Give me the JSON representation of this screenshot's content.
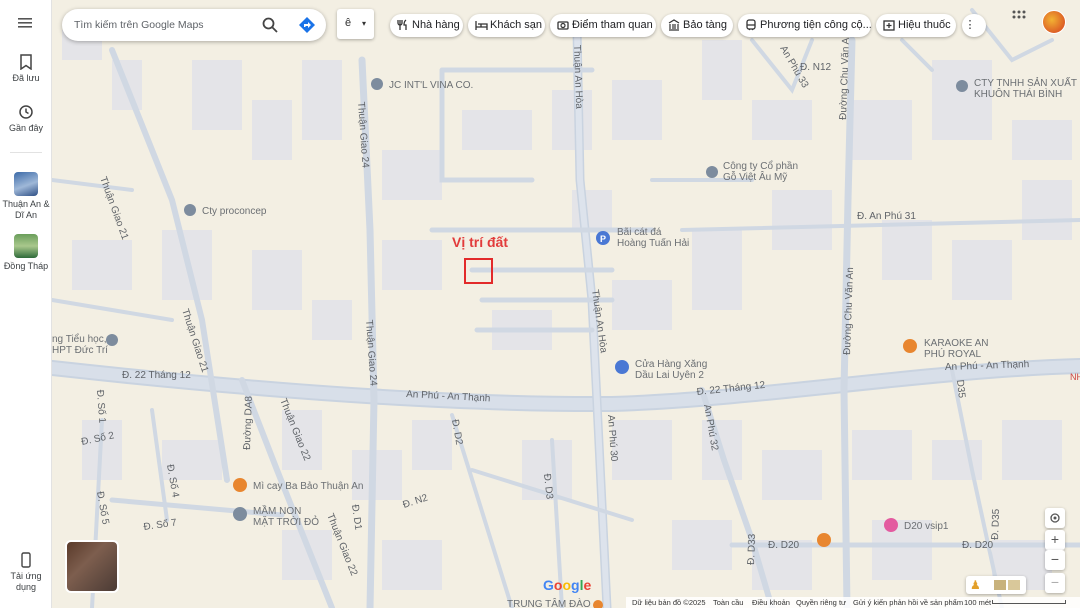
{
  "search": {
    "placeholder": "Tìm kiếm trên Google Maps",
    "menu_label": "Menu"
  },
  "lang": {
    "label": "ê"
  },
  "chips": [
    {
      "label": "Nhà hàng",
      "icon": "fork-knife-icon"
    },
    {
      "label": "Khách sạn",
      "icon": "bed-icon"
    },
    {
      "label": "Điểm tham quan",
      "icon": "camera-icon"
    },
    {
      "label": "Bảo tàng",
      "icon": "museum-icon"
    },
    {
      "label": "Phương tiện công cộ...",
      "icon": "transit-icon"
    },
    {
      "label": "Hiệu thuốc",
      "icon": "pharmacy-icon"
    }
  ],
  "rail": {
    "saved": "Đã lưu",
    "recent": "Gần đây",
    "recent1": "Thuận An & Dĩ An",
    "recent2": "Đồng Tháp",
    "get_app": "Tải ứng dụng"
  },
  "annotation": {
    "title": "Vị trí đất",
    "color": "#e23b3b"
  },
  "streets": {
    "s22thang12_a": "Đ. 22 Tháng 12",
    "s22thang12_b": "Đ. 22 Tháng 12",
    "anphu_a": "An Phú - An Thạnh",
    "anphu_b": "An Phú - An Thạnh",
    "thuanangiao21": "Thuận Giao 21",
    "thuanangiao21b": "Thuận Giao 21",
    "thuanangiao24": "Thuận Giao 24",
    "thuanangiao24b": "Thuận Giao 24",
    "thuanangiao22": "Thuận Giao 22",
    "thuanangiao22b": "Thuận Giao 22",
    "thuananhoa": "Thuận An Hòa",
    "thuananhoa2": "Thuận An Hòa",
    "chuvanan": "Đường Chu Văn An",
    "chuvanan2": "Đường Chu Văn An",
    "anphu31": "Đ. An Phú 31",
    "anphu32": "An Phú 32",
    "anphu30": "An Phú 30",
    "anphu33": "An Phú 33",
    "n12": "Đ. N12",
    "da8": "Đường DA8",
    "d2": "Đ. D2",
    "d1": "Đ. D1",
    "d3": "Đ. D3",
    "d33": "Đ. D33",
    "d35": "D35",
    "d35b": "Đ. D35",
    "d20": "Đ. D20",
    "d20b": "Đ. D20",
    "n2": "Đ. N2",
    "so1": "Đ. Số 1",
    "so2": "Đ. Số 2",
    "so4": "Đ. Số 4",
    "so5": "Đ. Số 5",
    "so7": "Đ. Số 7"
  },
  "pois": {
    "jc": "JC INT'L VINA CO.",
    "cty_sx_1": "CTY TNHH SẢN XUẤT",
    "cty_sx_2": "KHUÔN THÁI BÌNH",
    "goviet_1": "Công ty Cổ phần",
    "goviet_2": "Gỗ Việt Âu Mỹ",
    "proconcep": "Cty proconcep",
    "baicat_1": "Bãi cát đá",
    "baicat_2": "Hoàng Tuấn Hải",
    "xang_1": "Cửa Hàng Xăng",
    "xang_2": "Dầu Lai Uyên 2",
    "karaoke_1": "KARAOKE AN",
    "karaoke_2": "PHÚ ROYAL",
    "tieuhoc_1": "ng Tiểu học,",
    "tieuhoc_2": "HPT Đức Trí",
    "micay": "Mì cay Ba Bảo Thuận An",
    "mamnon_1": "MẦM NON",
    "mamnon_2": "MẶT TRỜI ĐỎ",
    "vsip": "D20 vsip1",
    "trungtam": "TRUNG TÂM ĐÀO",
    "nh": "NH"
  },
  "footer": {
    "data": "Dữ liệu bản đồ ©2025",
    "global": "Toàn cầu",
    "terms": "Điều khoản",
    "privacy": "Quyền riêng tư",
    "feedback": "Gửi ý kiến phản hồi về sản phẩm",
    "scale": "100 mét"
  },
  "brand": "Google",
  "controls": {
    "locate": "my-location-icon",
    "zoom_in": "+",
    "zoom_out": "−",
    "tilt": "−"
  }
}
